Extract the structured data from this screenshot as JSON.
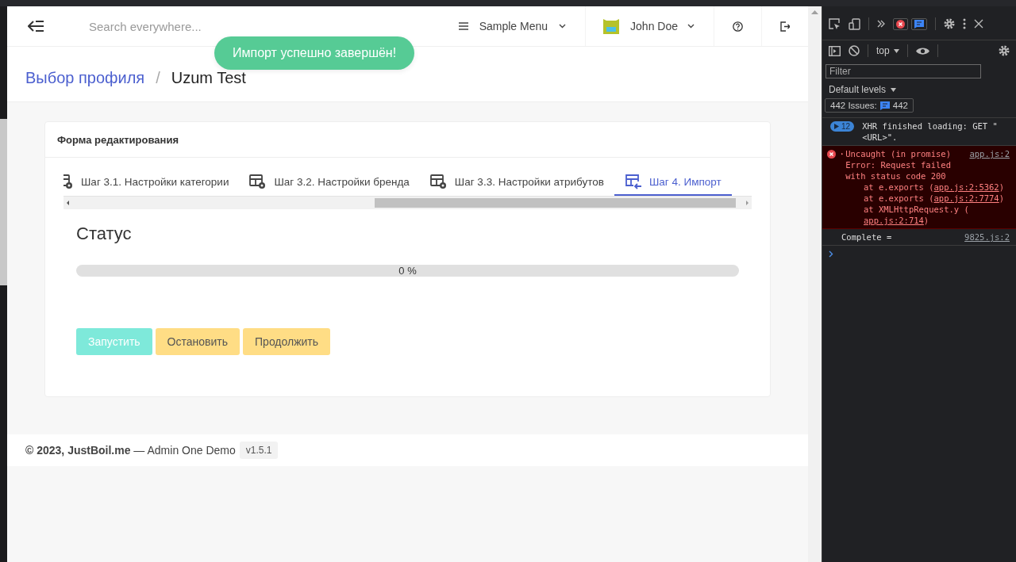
{
  "navbar": {
    "search": {
      "placeholder": "Search everywhere..."
    },
    "menu": {
      "label": "Sample Menu"
    },
    "user": {
      "name": "John Doe"
    }
  },
  "toast": {
    "message": "Импорт успешно завершён!"
  },
  "breadcrumb": [
    {
      "label": "Выбор профиля",
      "kind": "link"
    },
    {
      "label": "/",
      "kind": "separator"
    },
    {
      "label": "Uzum Test",
      "kind": "current"
    }
  ],
  "card": {
    "title": "Форма редактирования",
    "tabs": [
      {
        "label": "Шаг 3.1. Настройки категории",
        "kind": "settings",
        "selected": false
      },
      {
        "label": "Шаг 3.2. Настройки бренда",
        "kind": "settings",
        "selected": false
      },
      {
        "label": "Шаг 3.3. Настройки атрибутов",
        "kind": "settings",
        "selected": false
      },
      {
        "label": "Шаг 4. Импорт",
        "kind": "import",
        "selected": true
      }
    ],
    "status": {
      "heading": "Статус",
      "progress": {
        "level": 0,
        "reading": "0 %"
      }
    },
    "buttons": [
      {
        "label": "Запустить",
        "kind": "primary",
        "disabled": true
      },
      {
        "label": "Остановить",
        "kind": "warning",
        "disabled": false
      },
      {
        "label": "Продолжить",
        "kind": "warning",
        "disabled": false
      }
    ]
  },
  "footer": {
    "text": "**© 2023, JustBoil.me** — Admin One Demo",
    "version": "v1.5.1"
  },
  "devtools": {
    "context": "top",
    "filter": {
      "placeholder": "Filter"
    },
    "levels": "Default levels",
    "issues": {
      "label": "442 Issues:",
      "count": "442"
    },
    "messages": [
      {
        "kind": "group",
        "count": "12",
        "text": "XHR finished loading: GET \"<URL>\"."
      },
      {
        "kind": "error",
        "text": "Uncaught (in promise) Error: Request failed with status code 200",
        "source": "app.js:2",
        "stack": [
          {
            "text": "at e.exports (",
            "link": "app.js:2:5362",
            "end": ")"
          },
          {
            "text": "at e.exports (",
            "link": "app.js:2:7774",
            "end": ")"
          },
          {
            "text": "at XMLHttpRequest.y (",
            "link": "app.js:2:714",
            "end": ")"
          }
        ]
      },
      {
        "kind": "log",
        "text": "Complete =",
        "source": "9825.js:2"
      }
    ]
  }
}
